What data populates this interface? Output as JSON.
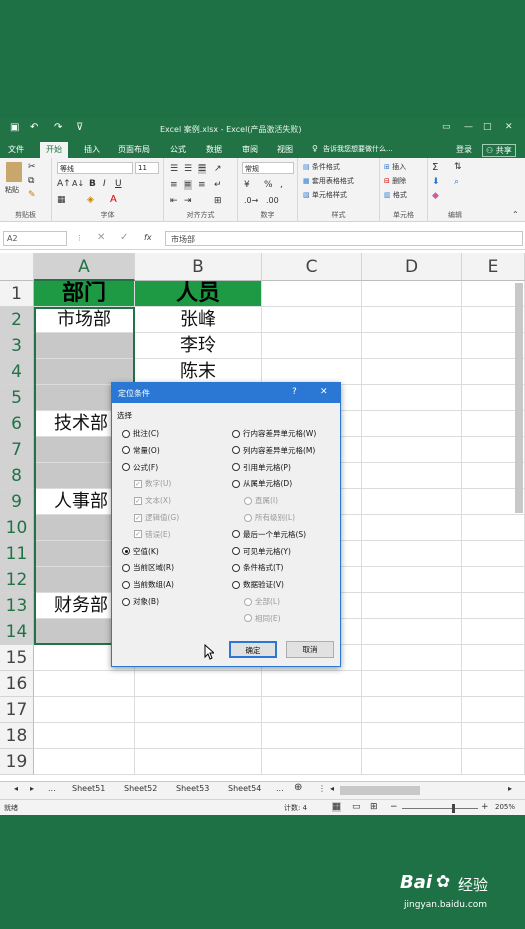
{
  "window": {
    "title": "Excel 案例.xlsx - Excel(产品激活失败)",
    "user": "登录",
    "share": "共享"
  },
  "ribbon_tabs": [
    "文件",
    "开始",
    "插入",
    "页面布局",
    "公式",
    "数据",
    "审阅",
    "视图"
  ],
  "tell_me": "告诉我您想要做什么...",
  "ribbon": {
    "paste": "粘贴",
    "clipboard": "剪贴板",
    "font_name": "等线",
    "font_size": "11",
    "font_group": "字体",
    "align_group": "对齐方式",
    "number_format": "常规",
    "number_group": "数字",
    "cond_format": "条件格式",
    "table_format": "套用表格格式",
    "cell_style": "单元格样式",
    "style_group": "样式",
    "insert": "插入",
    "delete": "删除",
    "format": "格式",
    "cells_group": "单元格",
    "edit_group": "编辑"
  },
  "formula_bar": {
    "name_box": "A2",
    "fx": "fx",
    "content": "市场部"
  },
  "grid": {
    "columns": [
      "A",
      "B",
      "C",
      "D",
      "E"
    ],
    "rows": [
      "1",
      "2",
      "3",
      "4",
      "5",
      "6",
      "7",
      "8",
      "9",
      "10",
      "11",
      "12",
      "13",
      "14",
      "15",
      "16",
      "17",
      "18",
      "19"
    ],
    "cells": {
      "A1": "部门",
      "B1": "人员",
      "A2": "市场部",
      "B2": "张峰",
      "B3": "李玲",
      "B4": "陈末",
      "A6": "技术部",
      "A9": "人事部",
      "A13": "财务部"
    }
  },
  "sheet_tabs": [
    "...",
    "Sheet51",
    "Sheet52",
    "Sheet53",
    "Sheet54",
    "..."
  ],
  "status": {
    "ready": "就绪",
    "count": "计数: 4",
    "zoom": "205%"
  },
  "dialog": {
    "title": "定位条件",
    "help": "?",
    "close": "✕",
    "section": "选择",
    "left_options": [
      {
        "label": "批注(C)",
        "state": "off",
        "kind": "radio"
      },
      {
        "label": "常量(O)",
        "state": "off",
        "kind": "radio"
      },
      {
        "label": "公式(F)",
        "state": "off",
        "kind": "radio"
      },
      {
        "label": "数字(U)",
        "state": "dis",
        "kind": "check"
      },
      {
        "label": "文本(X)",
        "state": "dis",
        "kind": "check"
      },
      {
        "label": "逻辑值(G)",
        "state": "dis",
        "kind": "check"
      },
      {
        "label": "错误(E)",
        "state": "dis",
        "kind": "check"
      },
      {
        "label": "空值(K)",
        "state": "on",
        "kind": "radio"
      },
      {
        "label": "当前区域(R)",
        "state": "off",
        "kind": "radio"
      },
      {
        "label": "当前数组(A)",
        "state": "off",
        "kind": "radio"
      },
      {
        "label": "对象(B)",
        "state": "off",
        "kind": "radio"
      }
    ],
    "right_options": [
      {
        "label": "行内容差异单元格(W)",
        "state": "off",
        "kind": "radio"
      },
      {
        "label": "列内容差异单元格(M)",
        "state": "off",
        "kind": "radio"
      },
      {
        "label": "引用单元格(P)",
        "state": "off",
        "kind": "radio"
      },
      {
        "label": "从属单元格(D)",
        "state": "off",
        "kind": "radio"
      },
      {
        "label": "直属(I)",
        "state": "dis",
        "kind": "radio"
      },
      {
        "label": "所有级别(L)",
        "state": "dis",
        "kind": "radio"
      },
      {
        "label": "最后一个单元格(S)",
        "state": "off",
        "kind": "radio"
      },
      {
        "label": "可见单元格(Y)",
        "state": "off",
        "kind": "radio"
      },
      {
        "label": "条件格式(T)",
        "state": "off",
        "kind": "radio"
      },
      {
        "label": "数据验证(V)",
        "state": "off",
        "kind": "radio"
      },
      {
        "label": "全部(L)",
        "state": "dis",
        "kind": "radio"
      },
      {
        "label": "相同(E)",
        "state": "dis",
        "kind": "radio"
      }
    ],
    "ok": "确定",
    "cancel": "取消"
  },
  "watermark": {
    "brand": "Bai",
    "brand2": "经验",
    "url": "jingyan.baidu.com"
  }
}
